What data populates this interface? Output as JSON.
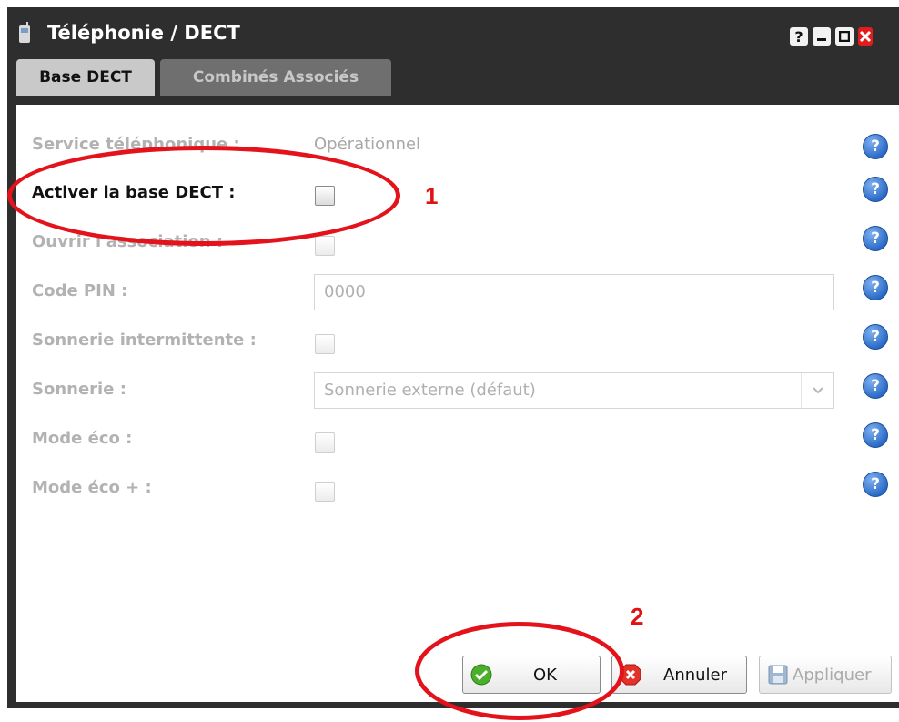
{
  "window": {
    "title": "Téléphonie / DECT",
    "controls": [
      "?",
      "–",
      "□",
      "✕"
    ],
    "background_color": "#2e2e2e"
  },
  "tabs": [
    {
      "label": "Base DECT",
      "active": true
    },
    {
      "label": "Combinés Associés",
      "active": false
    }
  ],
  "form": {
    "service": {
      "label": "Service téléphonique :",
      "value": "Opérationnel"
    },
    "activate_base": {
      "label": "Activer la base DECT :",
      "checked": false,
      "enabled": true
    },
    "open_association": {
      "label": "Ouvrir l'association :",
      "checked": false,
      "enabled": false
    },
    "pin_code": {
      "label": "Code PIN :",
      "value": "0000",
      "enabled": false
    },
    "intermittent_ring": {
      "label": "Sonnerie intermittente :",
      "checked": false,
      "enabled": false
    },
    "ringtone": {
      "label": "Sonnerie :",
      "selected": "Sonnerie externe (défaut)",
      "enabled": false
    },
    "eco_mode": {
      "label": "Mode éco :",
      "checked": false,
      "enabled": false
    },
    "eco_plus_mode": {
      "label": "Mode éco + :",
      "checked": false,
      "enabled": false
    }
  },
  "help_icon": "?",
  "buttons": {
    "ok": "OK",
    "cancel": "Annuler",
    "apply": "Appliquer"
  },
  "annotations": {
    "step1": "1",
    "step2": "2",
    "color": "#e3121b"
  }
}
